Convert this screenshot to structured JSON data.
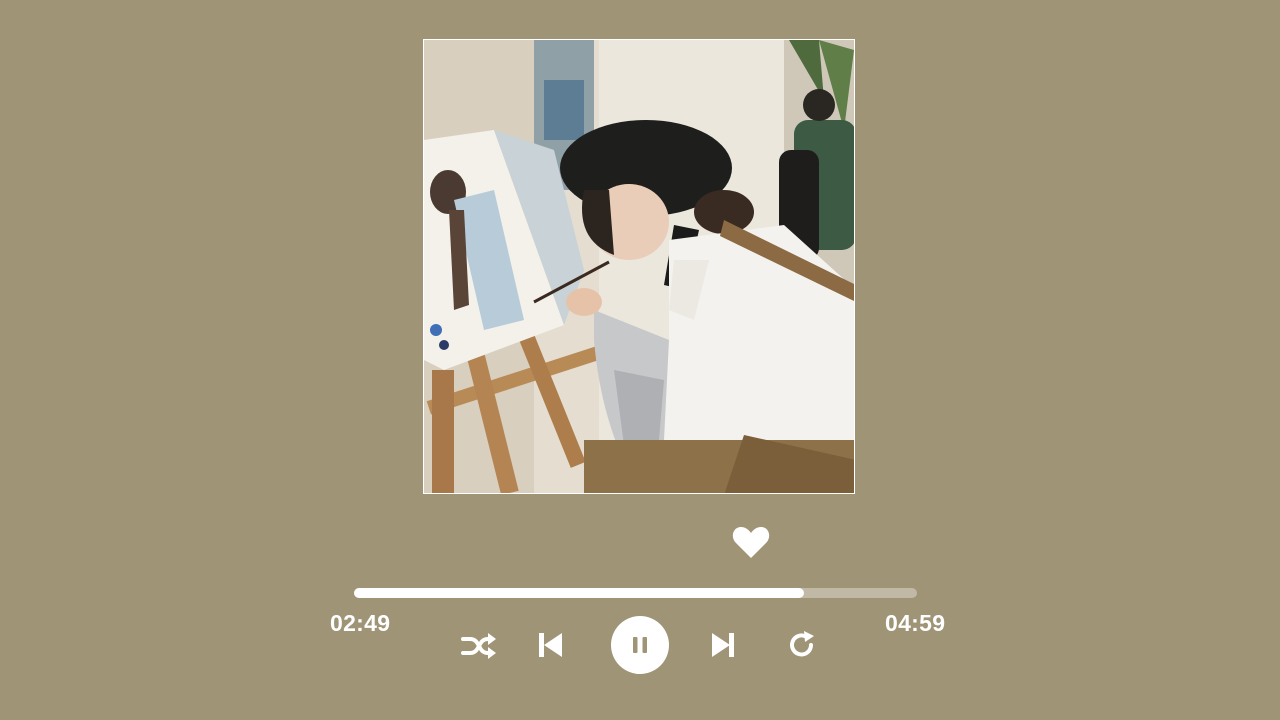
{
  "player": {
    "artwork": {
      "description_icon": "album-artwork-image"
    },
    "like": {
      "icon": "heart-icon",
      "liked": true
    },
    "progress": {
      "elapsed": "02:49",
      "total": "04:59",
      "fraction": 0.8
    },
    "controls": [
      {
        "name": "shuffle",
        "icon": "shuffle-icon"
      },
      {
        "name": "previous",
        "icon": "skip-previous-icon"
      },
      {
        "name": "pause",
        "icon": "pause-icon"
      },
      {
        "name": "next",
        "icon": "skip-next-icon"
      },
      {
        "name": "repeat",
        "icon": "repeat-icon"
      }
    ]
  },
  "colors": {
    "background": "#a09477",
    "foreground": "#ffffff",
    "track": "rgba(255,255,255,0.35)"
  }
}
